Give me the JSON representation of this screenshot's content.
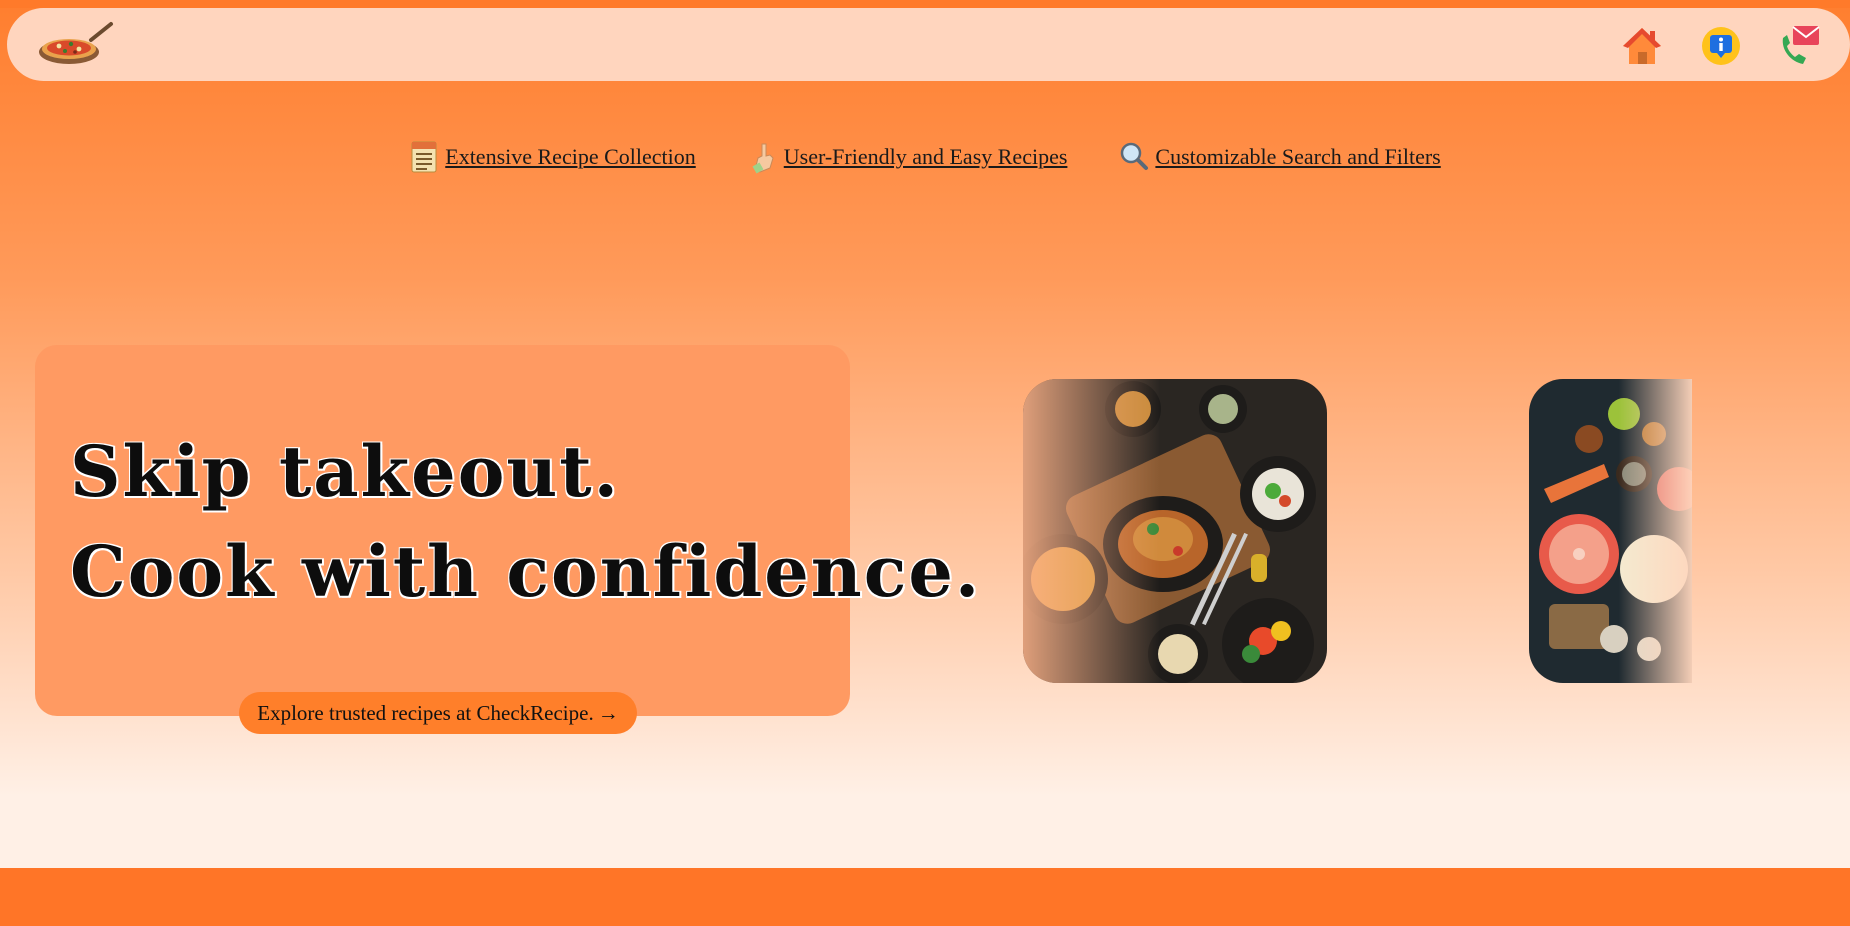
{
  "navbar": {
    "logo_icon": "pizza-logo-icon",
    "icons": [
      "home-icon",
      "info-icon",
      "contact-phone-mail-icon"
    ]
  },
  "features": [
    {
      "icon": "recipe-note-icon",
      "label": "Extensive Recipe Collection"
    },
    {
      "icon": "pointing-hand-icon",
      "label": "User-Friendly and Easy Recipes"
    },
    {
      "icon": "magnifier-icon",
      "label": "Customizable Search and Filters"
    }
  ],
  "hero": {
    "line1": "Skip takeout.",
    "line2": "Cook with confidence.",
    "cta_label": "Explore trusted recipes at CheckRecipe.",
    "cta_arrow": "→"
  },
  "images": [
    "roast-chicken-dishes-image",
    "fruits-vegetables-image"
  ],
  "colors": {
    "accent": "#ff7a2a",
    "navbar_bg": "#ffd5be",
    "hero_card": "#ff9a62"
  }
}
